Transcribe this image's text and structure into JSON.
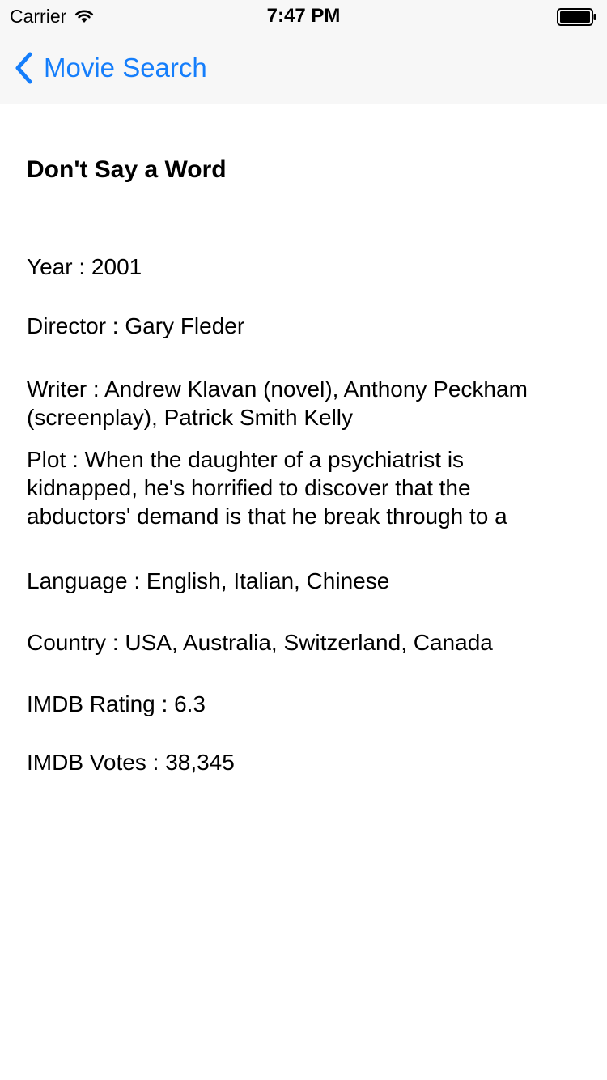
{
  "status_bar": {
    "carrier": "Carrier",
    "time": "7:47 PM"
  },
  "nav": {
    "back_label": "Movie Search"
  },
  "movie": {
    "title": "Don't Say a Word",
    "separator": " : ",
    "fields": {
      "year": {
        "label": "Year",
        "value": "2001"
      },
      "director": {
        "label": "Director",
        "value": "Gary Fleder"
      },
      "writer": {
        "label": "Writer",
        "value": "Andrew Klavan (novel), Anthony Peckham (screenplay), Patrick Smith Kelly"
      },
      "plot": {
        "label": "Plot",
        "value": "When the daughter of a psychiatrist is kidnapped, he's horrified to discover that the abductors' demand is that he break through to a"
      },
      "language": {
        "label": "Language",
        "value": "English, Italian, Chinese"
      },
      "country": {
        "label": "Country",
        "value": "USA, Australia, Switzerland, Canada"
      },
      "imdb_rating": {
        "label": "IMDB Rating",
        "value": "6.3"
      },
      "imdb_votes": {
        "label": "IMDB Votes",
        "value": "38,345"
      }
    }
  },
  "colors": {
    "accent": "#157efb",
    "bar_background": "#f7f7f7",
    "separator": "#b2b2b2"
  },
  "icons": {
    "back": "chevron-left-icon",
    "wifi": "wifi-icon",
    "battery": "battery-icon"
  }
}
